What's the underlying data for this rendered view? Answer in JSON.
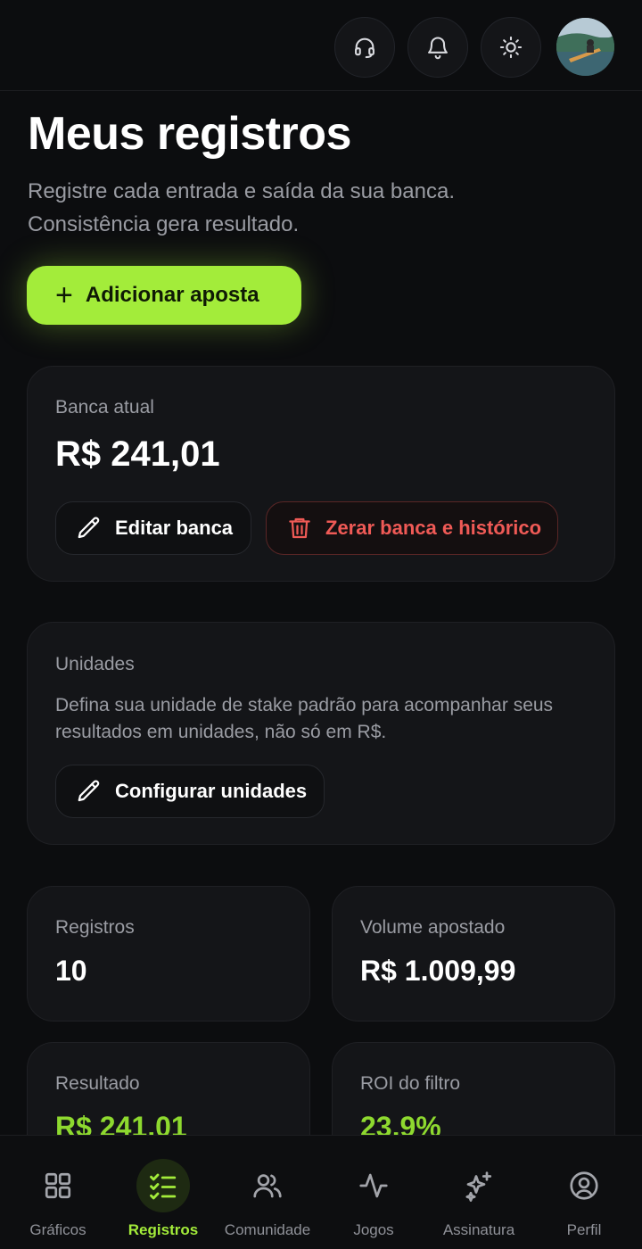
{
  "header": {
    "icons": [
      "headset-icon",
      "bell-icon",
      "sun-icon"
    ],
    "avatar": "avatar"
  },
  "page": {
    "title": "Meus registros",
    "subtitle": "Registre cada entrada e saída da sua banca. Consistência gera resultado.",
    "add_button": "Adicionar aposta"
  },
  "bank": {
    "label": "Banca atual",
    "value": "R$ 241,01",
    "edit_button": "Editar banca",
    "reset_button": "Zerar banca e histórico"
  },
  "units": {
    "label": "Unidades",
    "description": "Defina sua unidade de stake padrão para acompanhar seus resultados em unidades, não só em R$.",
    "configure_button": "Configurar unidades"
  },
  "stats": {
    "records_label": "Registros",
    "records_value": "10",
    "volume_label": "Volume apostado",
    "volume_value": "R$ 1.009,99",
    "result_label": "Resultado",
    "result_value": "R$ 241,01",
    "roi_label": "ROI do filtro",
    "roi_value": "23,9%"
  },
  "colors": {
    "accent": "#a3ec3a",
    "positive": "#8ed92f",
    "danger": "#ef5a56",
    "background": "#0c0d0f",
    "card": "#141518"
  },
  "nav": {
    "items": [
      {
        "label": "Gráficos",
        "icon": "grid-icon"
      },
      {
        "label": "Registros",
        "icon": "checklist-icon"
      },
      {
        "label": "Comunidade",
        "icon": "users-icon"
      },
      {
        "label": "Jogos",
        "icon": "activity-icon"
      },
      {
        "label": "Assinatura",
        "icon": "sparkles-icon"
      },
      {
        "label": "Perfil",
        "icon": "user-circle-icon"
      }
    ],
    "active": "Registros"
  }
}
